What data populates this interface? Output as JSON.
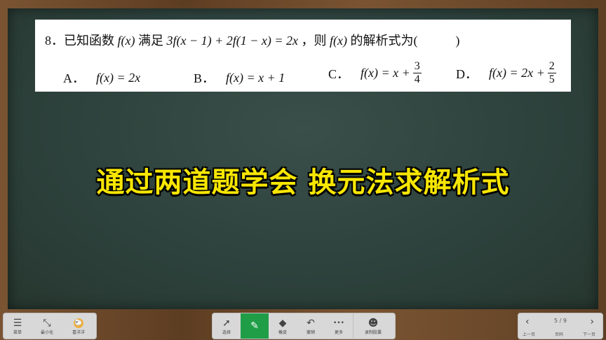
{
  "question": {
    "prefix": "8．已知函数",
    "fx1": "f(x)",
    "condition_word": "满足",
    "equation": "3f(x − 1) + 2f(1 − x) = 2x",
    "then_word": "，则",
    "fx2": "f(x)",
    "suffix": "的解析式为(　　　)"
  },
  "options": [
    {
      "label": "A．",
      "expr": "f(x) = 2x",
      "frac_num": "",
      "frac_den": ""
    },
    {
      "label": "B．",
      "expr": "f(x) = x + 1",
      "frac_num": "",
      "frac_den": ""
    },
    {
      "label": "C．",
      "expr": "f(x) = x +",
      "frac_num": "3",
      "frac_den": "4"
    },
    {
      "label": "D．",
      "expr": "f(x) = 2x +",
      "frac_num": "2",
      "frac_den": "5"
    }
  ],
  "headline": "通过两道题学会 换元法求解析式",
  "toolbar_left": [
    {
      "name": "menu",
      "icon": "menu-icon",
      "glyph": "☰",
      "label": "菜单"
    },
    {
      "name": "minimize",
      "icon": "minimize-icon",
      "glyph": "⤡",
      "label": "最小化"
    },
    {
      "name": "xiyangyang",
      "icon": "avatar-icon",
      "glyph": "",
      "label": "喜洋洋"
    }
  ],
  "toolbar_center": [
    {
      "name": "select",
      "icon": "cursor-icon",
      "glyph": "➚",
      "label": "选择",
      "active": false
    },
    {
      "name": "pen",
      "icon": "pen-icon",
      "glyph": "✎",
      "label": "",
      "active": true
    },
    {
      "name": "eraser",
      "icon": "eraser-icon",
      "glyph": "◆",
      "label": "橡皮",
      "active": false
    },
    {
      "name": "undo",
      "icon": "undo-icon",
      "glyph": "↶",
      "label": "撤销",
      "active": false
    },
    {
      "name": "more",
      "icon": "more-icon",
      "glyph": "•••",
      "label": "更多",
      "active": false
    }
  ],
  "toolbar_record": {
    "name": "record",
    "icon": "record-icon",
    "glyph": "☻",
    "label": "录制胶囊"
  },
  "page_nav": {
    "current": "5 / 9",
    "prev_label": "上一页",
    "page_label": "页码",
    "next_label": "下一页"
  },
  "colors": {
    "board": "#2e423d",
    "frame": "#6b4a2a",
    "headline": "#f7e600",
    "active_tool": "#1f9e47"
  }
}
